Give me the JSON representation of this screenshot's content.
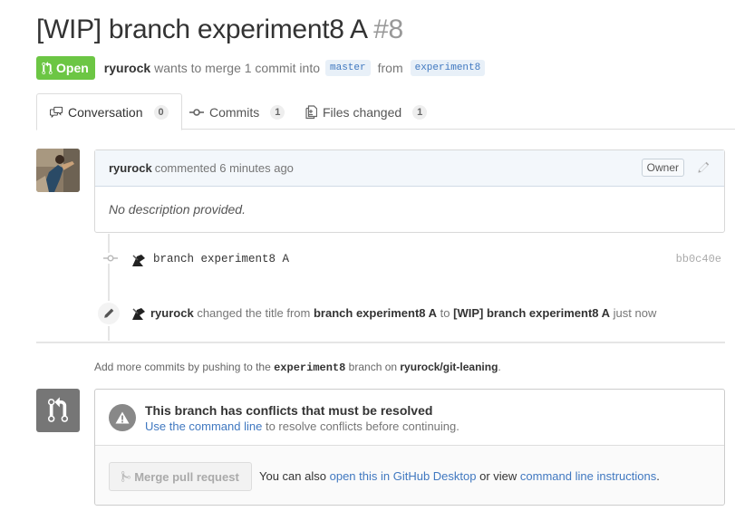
{
  "header": {
    "title": "[WIP] branch experiment8 A",
    "number": "#8",
    "state": "Open",
    "author": "ryurock",
    "action_text": "wants to merge 1 commit into",
    "base_branch": "master",
    "from_text": "from",
    "head_branch": "experiment8"
  },
  "tabs": [
    {
      "label": "Conversation",
      "count": "0",
      "icon": "comment-discussion-icon",
      "selected": true
    },
    {
      "label": "Commits",
      "count": "1",
      "icon": "git-commit-icon",
      "selected": false
    },
    {
      "label": "Files changed",
      "count": "1",
      "icon": "diff-icon",
      "selected": false
    }
  ],
  "comment": {
    "author": "ryurock",
    "meta": "commented 6 minutes ago",
    "role": "Owner",
    "body": "No description provided."
  },
  "commit": {
    "message": "branch experiment8 A",
    "sha": "bb0c40e"
  },
  "event": {
    "actor": "ryurock",
    "text1": "changed the title from",
    "old_title": "branch experiment8 A",
    "text2": "to",
    "new_title": "[WIP] branch experiment8 A",
    "time": "just now"
  },
  "push_hint": {
    "prefix": "Add more commits by pushing to the",
    "branch": "experiment8",
    "mid": "branch on",
    "repo": "ryurock/git-leaning",
    "suffix": "."
  },
  "merge": {
    "status_title": "This branch has conflicts that must be resolved",
    "status_link": "Use the command line",
    "status_rest": "to resolve conflicts before continuing.",
    "button_label": "Merge pull request",
    "alt_prefix": "You can also",
    "alt_link1": "open this in GitHub Desktop",
    "alt_mid": "or view",
    "alt_link2": "command line instructions",
    "alt_suffix": "."
  },
  "colors": {
    "open_badge": "#6cc644",
    "link": "#4078c0",
    "muted": "#767676"
  }
}
